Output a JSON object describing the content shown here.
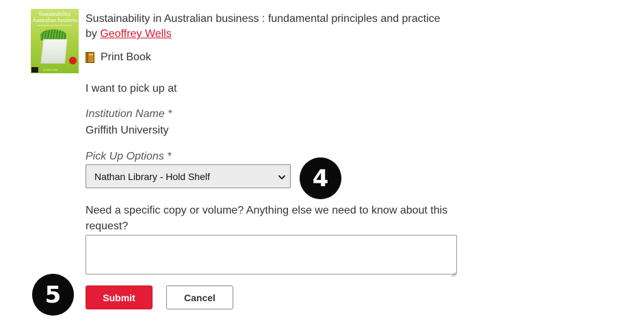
{
  "book": {
    "cover": {
      "title_line1": "Sustainability",
      "title_line2": "Australian business",
      "subtitle": "fundamental principles and practice",
      "author": "Geoffrey Wells"
    },
    "title": "Sustainability in Australian business : fundamental principles and practice",
    "by_label": "by",
    "author": "Geoffrey  Wells",
    "format_icon": "book-icon",
    "format": "Print Book"
  },
  "form": {
    "pickup_intro": "I want to pick up at",
    "institution_label": "Institution Name *",
    "institution_value": "Griffith University",
    "pickup_options_label": "Pick Up Options *",
    "pickup_selected": "Nathan Library - Hold Shelf",
    "notes_label": "Need a specific copy or volume? Anything else we need to know about this request?",
    "notes_value": "",
    "submit_label": "Submit",
    "cancel_label": "Cancel"
  },
  "annotations": {
    "step4": "4",
    "step5": "5"
  },
  "colors": {
    "accent": "#e31d35",
    "link": "#d7172f",
    "text": "#333333",
    "badge": "#0a0a0a"
  }
}
